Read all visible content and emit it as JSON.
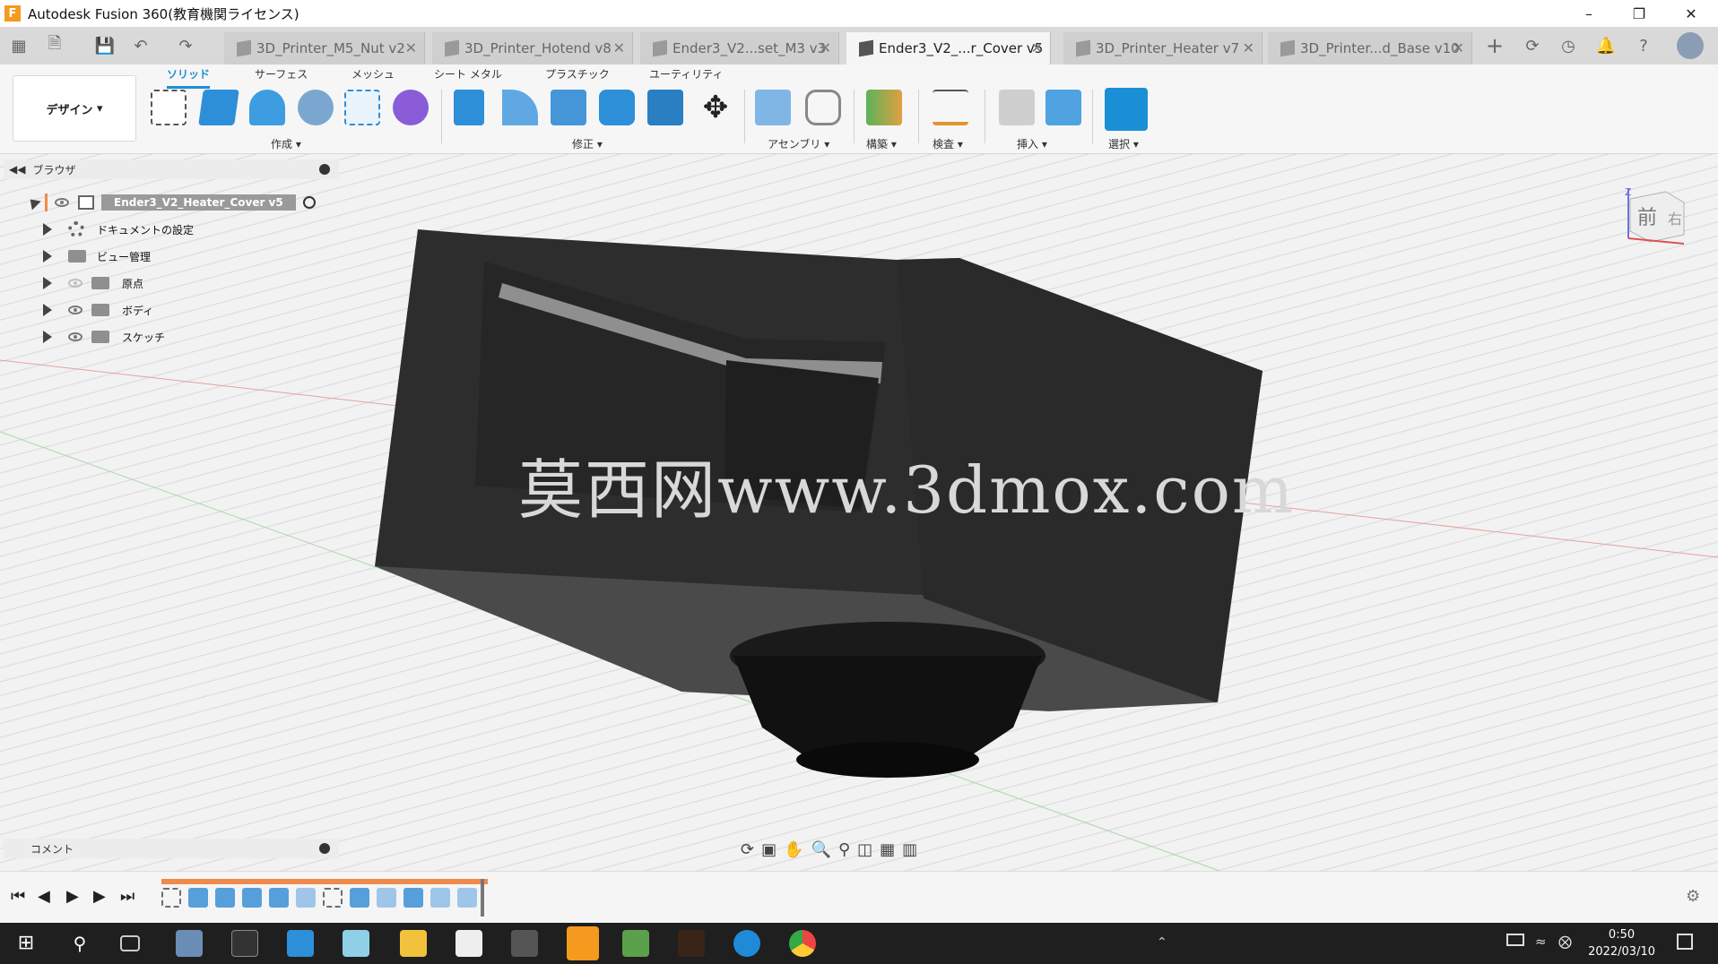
{
  "window": {
    "title": "Autodesk Fusion 360(教育機関ライセンス)",
    "app_icon": "F"
  },
  "tabs": [
    {
      "label": "3D_Printer_M5_Nut v2"
    },
    {
      "label": "3D_Printer_Hotend v8"
    },
    {
      "label": "Ender3_V2...set_M3 v3"
    },
    {
      "label": "Ender3_V2_...r_Cover v5"
    },
    {
      "label": "3D_Printer_Heater v7"
    },
    {
      "label": "3D_Printer...d_Base v10"
    }
  ],
  "ribbon": {
    "workspace": "デザイン",
    "tabs": [
      "ソリッド",
      "サーフェス",
      "メッシュ",
      "シート メタル",
      "プラスチック",
      "ユーティリティ"
    ],
    "groups": [
      "作成",
      "修正",
      "アセンブリ",
      "構築",
      "検査",
      "挿入",
      "選択"
    ]
  },
  "browser": {
    "title": "ブラウザ",
    "root": "Ender3_V2_Heater_Cover v5",
    "items": [
      "ドキュメントの設定",
      "ビュー管理",
      "原点",
      "ボディ",
      "スケッチ"
    ]
  },
  "comments": {
    "title": "コメント"
  },
  "viewcube": {
    "front": "前",
    "right": "右",
    "z": "Z"
  },
  "watermark": "莫西网www.3dmox.com",
  "taskbar": {
    "time": "0:50",
    "date": "2022/03/10"
  },
  "colors": {
    "accent": "#1b8fd6",
    "timeline_marker": "#f08a4b"
  }
}
